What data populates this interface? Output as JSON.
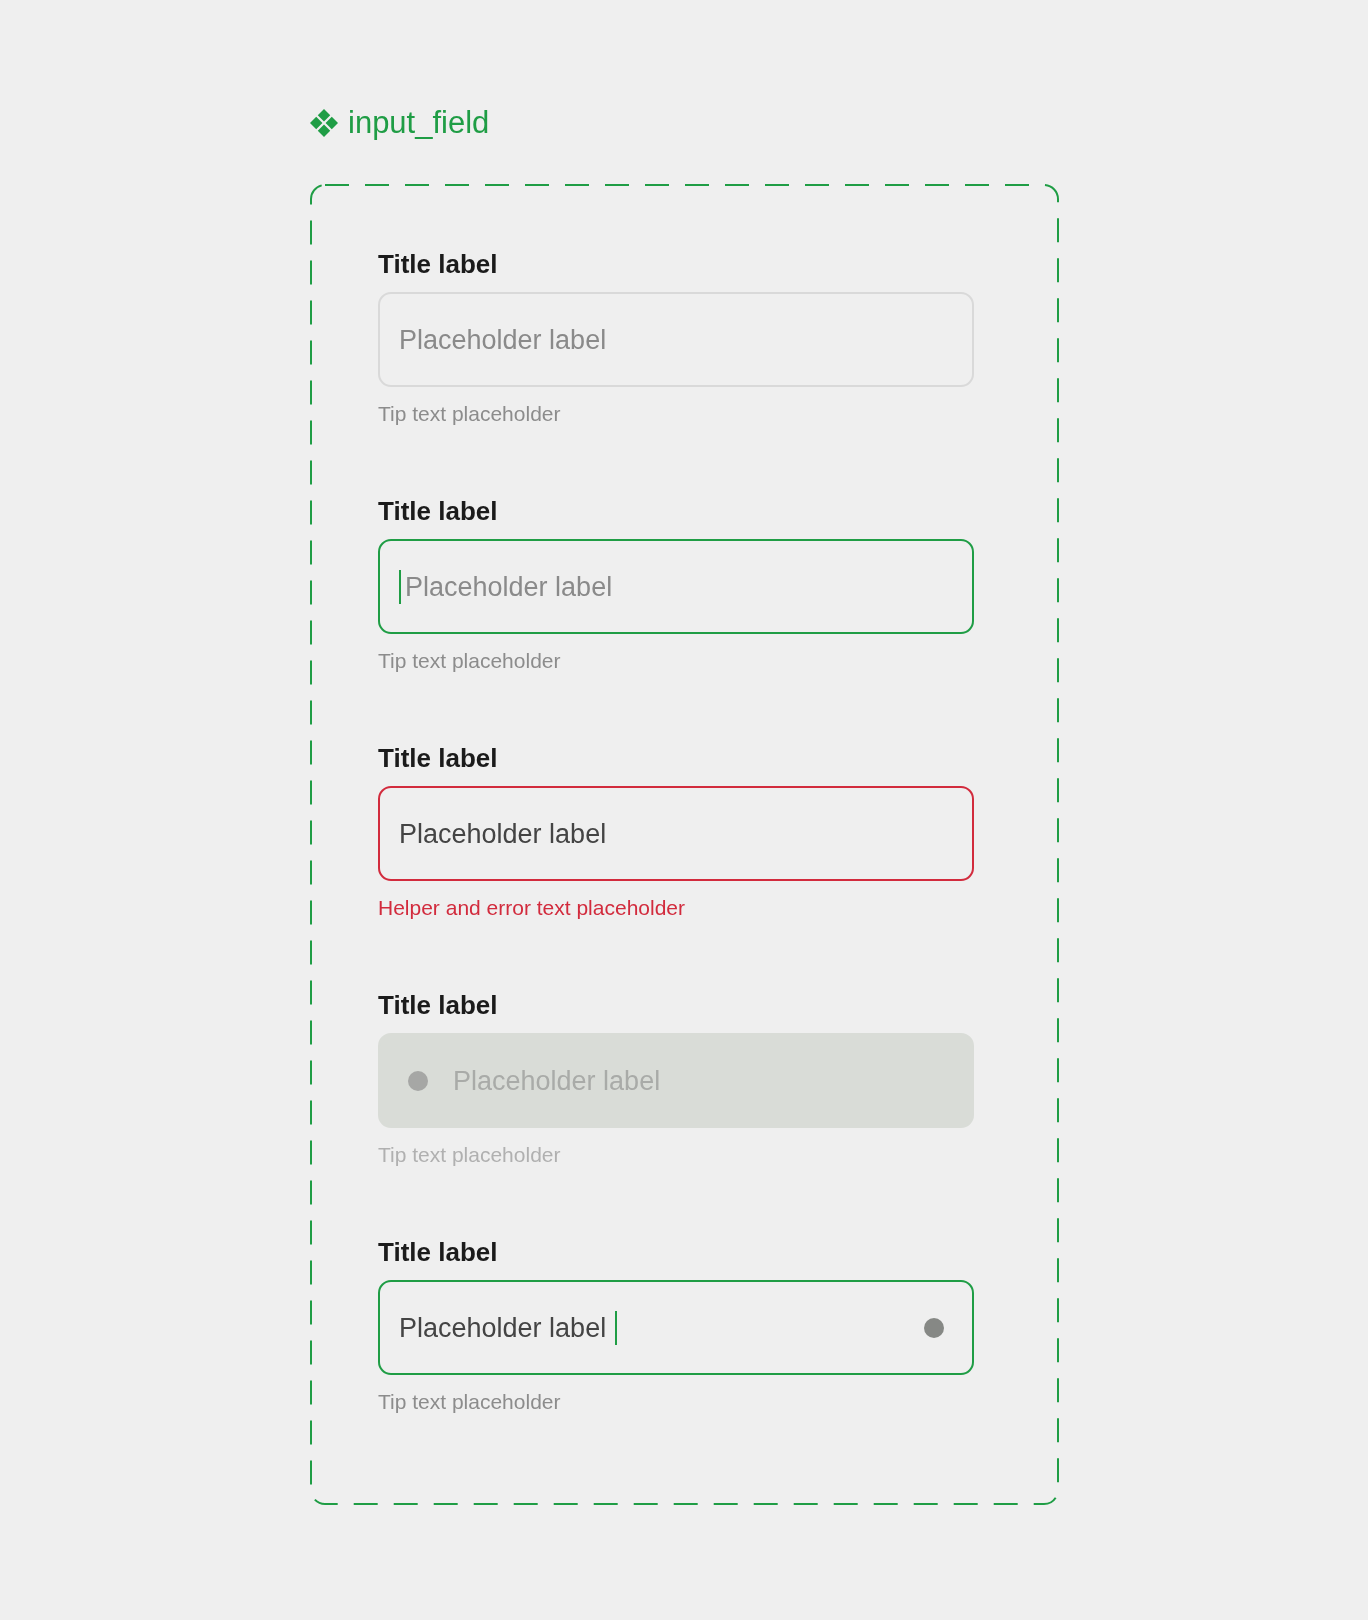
{
  "header": {
    "title": "input_field"
  },
  "fields": [
    {
      "kind": "default",
      "title": "Title label",
      "placeholder": "Placeholder label",
      "leading_icon": false,
      "trailing_icon": false,
      "helper": "Tip text placeholder"
    },
    {
      "kind": "focused",
      "title": "Title label",
      "placeholder": "Placeholder label",
      "leading_icon": false,
      "trailing_icon": false,
      "helper": "Tip text placeholder"
    },
    {
      "kind": "error",
      "title": "Title label",
      "value": "Placeholder label",
      "leading_icon": false,
      "trailing_icon": false,
      "helper": "Helper and error text placeholder"
    },
    {
      "kind": "disabled",
      "title": "Title label",
      "placeholder": "Placeholder label",
      "leading_icon": true,
      "trailing_icon": false,
      "helper": "Tip text placeholder"
    },
    {
      "kind": "focused",
      "title": "Title label",
      "value": "Placeholder label",
      "leading_icon": false,
      "trailing_icon": true,
      "helper": "Tip text placeholder"
    }
  ]
}
